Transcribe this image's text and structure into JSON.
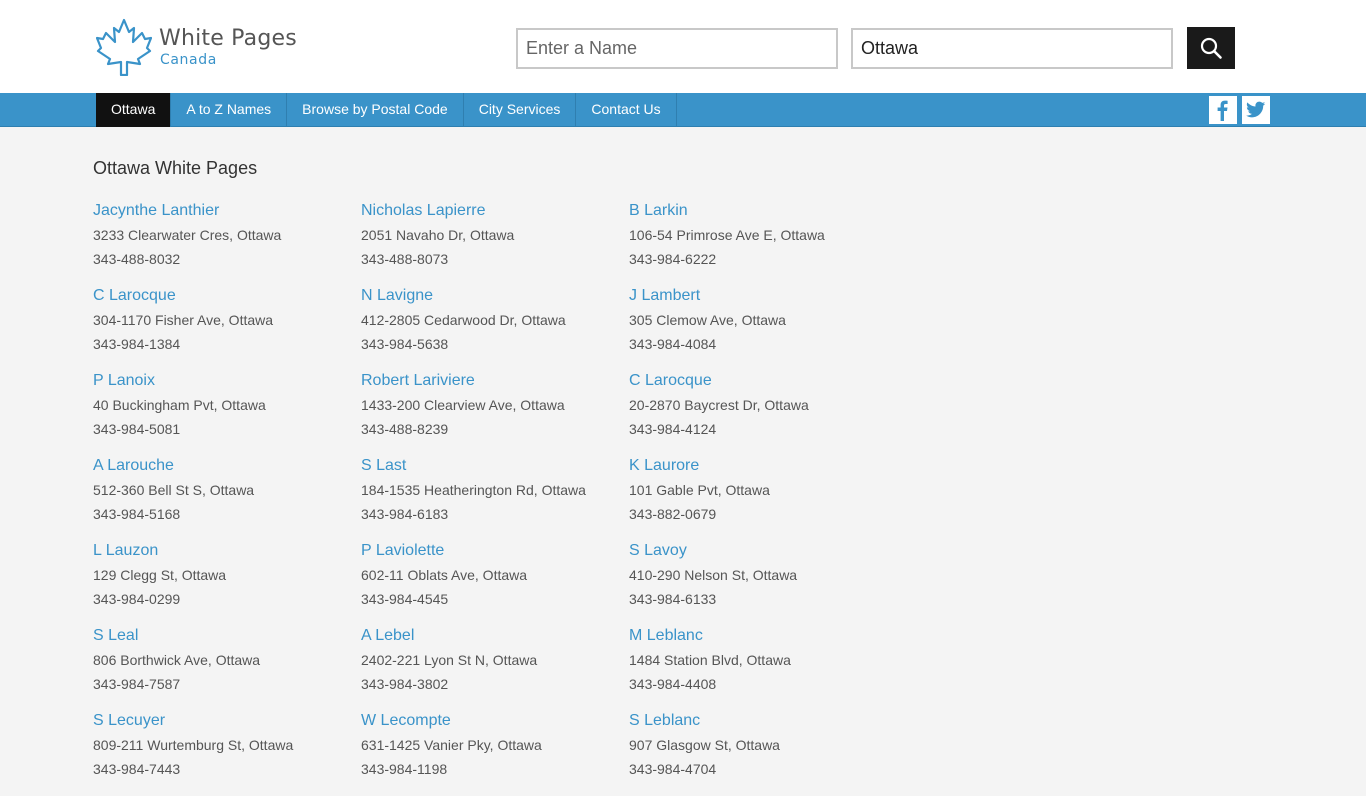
{
  "logo": {
    "title": "White Pages",
    "subtitle": "Canada"
  },
  "search": {
    "name_placeholder": "Enter a Name",
    "city_value": "Ottawa"
  },
  "nav": {
    "items": [
      {
        "label": "Ottawa",
        "active": true
      },
      {
        "label": "A to Z Names"
      },
      {
        "label": "Browse by Postal Code"
      },
      {
        "label": "City Services"
      },
      {
        "label": "Contact Us"
      }
    ]
  },
  "colors": {
    "accent": "#3a93c9",
    "dark": "#111111",
    "background": "#f4f4f4"
  },
  "icons": {
    "search": "magnifier-icon",
    "facebook": "facebook-icon",
    "twitter": "twitter-icon"
  },
  "page": {
    "title": "Ottawa White Pages"
  },
  "entries": [
    {
      "name": "Jacynthe Lanthier",
      "address": "3233 Clearwater Cres, Ottawa",
      "phone": "343-488-8032"
    },
    {
      "name": "Nicholas Lapierre",
      "address": "2051 Navaho Dr, Ottawa",
      "phone": "343-488-8073"
    },
    {
      "name": "B Larkin",
      "address": "106-54 Primrose Ave E, Ottawa",
      "phone": "343-984-6222"
    },
    {
      "name": "C Larocque",
      "address": "304-1170 Fisher Ave, Ottawa",
      "phone": "343-984-1384"
    },
    {
      "name": "N Lavigne",
      "address": "412-2805 Cedarwood Dr, Ottawa",
      "phone": "343-984-5638"
    },
    {
      "name": "J Lambert",
      "address": "305 Clemow Ave, Ottawa",
      "phone": "343-984-4084"
    },
    {
      "name": "P Lanoix",
      "address": "40 Buckingham Pvt, Ottawa",
      "phone": "343-984-5081"
    },
    {
      "name": "Robert Lariviere",
      "address": "1433-200 Clearview Ave, Ottawa",
      "phone": "343-488-8239"
    },
    {
      "name": "C Larocque",
      "address": "20-2870 Baycrest Dr, Ottawa",
      "phone": "343-984-4124"
    },
    {
      "name": "A Larouche",
      "address": "512-360 Bell St S, Ottawa",
      "phone": "343-984-5168"
    },
    {
      "name": "S Last",
      "address": "184-1535 Heatherington Rd, Ottawa",
      "phone": "343-984-6183"
    },
    {
      "name": "K Laurore",
      "address": "101 Gable Pvt, Ottawa",
      "phone": "343-882-0679"
    },
    {
      "name": "L Lauzon",
      "address": "129 Clegg St, Ottawa",
      "phone": "343-984-0299"
    },
    {
      "name": "P Laviolette",
      "address": "602-11 Oblats Ave, Ottawa",
      "phone": "343-984-4545"
    },
    {
      "name": "S Lavoy",
      "address": "410-290 Nelson St, Ottawa",
      "phone": "343-984-6133"
    },
    {
      "name": "S Leal",
      "address": "806 Borthwick Ave, Ottawa",
      "phone": "343-984-7587"
    },
    {
      "name": "A Lebel",
      "address": "2402-221 Lyon St N, Ottawa",
      "phone": "343-984-3802"
    },
    {
      "name": "M Leblanc",
      "address": "1484 Station Blvd, Ottawa",
      "phone": "343-984-4408"
    },
    {
      "name": "S Lecuyer",
      "address": "809-211 Wurtemburg St, Ottawa",
      "phone": "343-984-7443"
    },
    {
      "name": "W Lecompte",
      "address": "631-1425 Vanier Pky, Ottawa",
      "phone": "343-984-1198"
    },
    {
      "name": "S Leblanc",
      "address": "907 Glasgow St, Ottawa",
      "phone": "343-984-4704"
    }
  ]
}
